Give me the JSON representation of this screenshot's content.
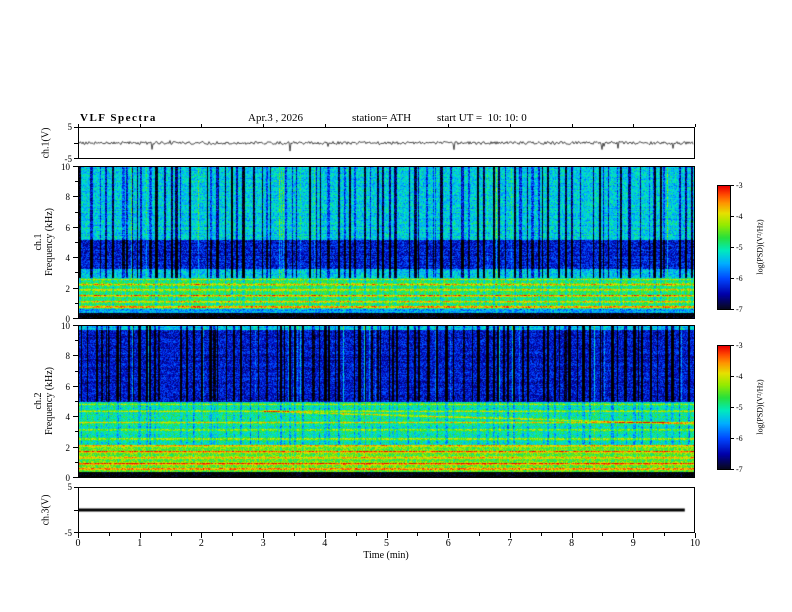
{
  "header": {
    "title": "VLF Spectra",
    "date": "Apr.3 , 2026",
    "station": "station= ATH",
    "start_ut": "start UT =  10: 10: 0"
  },
  "x_axis": {
    "label": "Time (min)",
    "major_ticks": [
      0,
      1,
      2,
      3,
      4,
      5,
      6,
      7,
      8,
      9,
      10
    ]
  },
  "freq_axis": {
    "unit": "kHz",
    "major_ticks": [
      0,
      2,
      4,
      6,
      8,
      10
    ]
  },
  "panels": {
    "ch1_wave": {
      "label": "ch.1(V)",
      "y_top": "5",
      "y_bottom": "-5"
    },
    "ch1_spec": {
      "label_line1": "ch.1",
      "label_line2": "Frequency (kHz)"
    },
    "ch2_spec": {
      "label_line1": "ch.2",
      "label_line2": "Frequency (kHz)"
    },
    "ch3_wave": {
      "label": "ch.3(V)",
      "y_top": "5",
      "y_bottom": "-5"
    }
  },
  "colorbar": {
    "label": "log(PSD)(V²/Hz)",
    "ticks": [
      "-3",
      "-4",
      "-5",
      "-6",
      "-7"
    ]
  },
  "chart_data": [
    {
      "type": "line",
      "panel": "ch.1(V) waveform",
      "xlabel": "Time (min)",
      "ylabel": "ch.1(V)",
      "xlim": [
        0,
        10
      ],
      "ylim": [
        -5,
        5
      ],
      "description": "Black noisy voltage trace centered near 0 V with small fluctuations (about ±0.5 V) and sporadic impulsive spikes reaching roughly -4 to +2 V throughout the 10-minute record."
    },
    {
      "type": "heatmap",
      "panel": "ch.1 spectrogram",
      "xlabel": "Time (min)",
      "ylabel": "Frequency (kHz)",
      "xlim": [
        0,
        10
      ],
      "ylim": [
        0,
        10
      ],
      "zlabel": "log(PSD)(V²/Hz)",
      "zlim": [
        -7,
        -3
      ],
      "colormap": "rainbow (black=-7, blue=-6, green=-5, yellow/orange=-4, red=-3)",
      "features": [
        "broadband green/cyan background near -5 above 5 kHz",
        "dark-blue low-power band between about 3 and 5 kHz",
        "dense narrow vertical blue dropout streaks across 2-10 kHz",
        "bright orange/red horizontal interference lines below ~2.5 kHz",
        "black band (<= -7) below ~0.3 kHz"
      ]
    },
    {
      "type": "heatmap",
      "panel": "ch.2 spectrogram",
      "xlabel": "Time (min)",
      "ylabel": "Frequency (kHz)",
      "xlim": [
        0,
        10
      ],
      "ylim": [
        0,
        10
      ],
      "zlabel": "log(PSD)(V²/Hz)",
      "zlim": [
        -7,
        -3
      ],
      "colormap": "rainbow (black=-7, blue=-6, green=-5, yellow/orange=-4, red=-3)",
      "features": [
        "dark-blue low-power region from ~5 to 10 kHz with dense vertical streaks",
        "green band between ~2 and 5 kHz crossed by red/orange horizontal lines near 2.5, 3.6 and 4.3-4.8 kHz",
        "faint red diagonal line descending from ~4.5 kHz toward 3.5 kHz after minute 3",
        "yellow/orange horizontal interference lines below ~2 kHz",
        "black band (<= -7) below ~0.3 kHz"
      ]
    },
    {
      "type": "line",
      "panel": "ch.3(V) waveform",
      "xlabel": "Time (min)",
      "ylabel": "ch.3(V)",
      "xlim": [
        0,
        10
      ],
      "ylim": [
        -5,
        5
      ],
      "description": "Flat thick black line at 0 V for the entire record (no signal on channel 3), ending at about 9.85 min."
    }
  ]
}
